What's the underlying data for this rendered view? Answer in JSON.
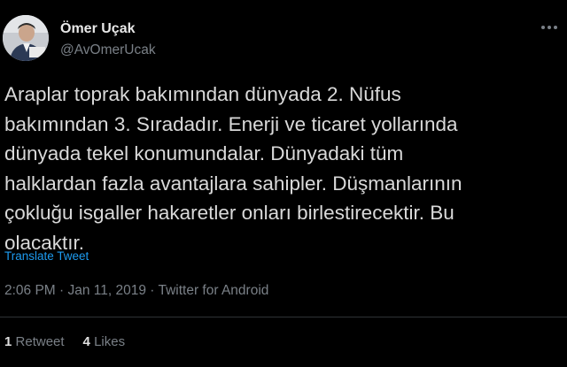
{
  "author": {
    "name": "Ömer Uçak",
    "handle": "@AvOmerUcak",
    "avatar_icon": "profile-photo"
  },
  "more_icon": "more-horizontal-icon",
  "tweet": {
    "lines": [
      "Araplar toprak bakımından dünyada 2. Nüfus",
      "bakımından 3. Sıradadır. Enerji ve ticaret yollarında",
      "dünyada tekel konumundalar. Dünyadaki tüm",
      "halklardan fazla avantajlara sahipler. Düşmanlarının",
      "çokluğu isgaller hakaretler onları birlestirecektir. Bu",
      "olacaktır."
    ],
    "translate_label": "Translate Tweet",
    "meta": "2:06 PM · Jan 11, 2019 · Twitter for Android"
  },
  "stats": {
    "retweets": {
      "count": "1",
      "label": "Retweet"
    },
    "likes": {
      "count": "4",
      "label": "Likes"
    }
  },
  "colors": {
    "background": "#000000",
    "text": "#d9d9d9",
    "secondary": "#7a8087",
    "link": "#1d9bf0",
    "divider": "#2f3336"
  }
}
